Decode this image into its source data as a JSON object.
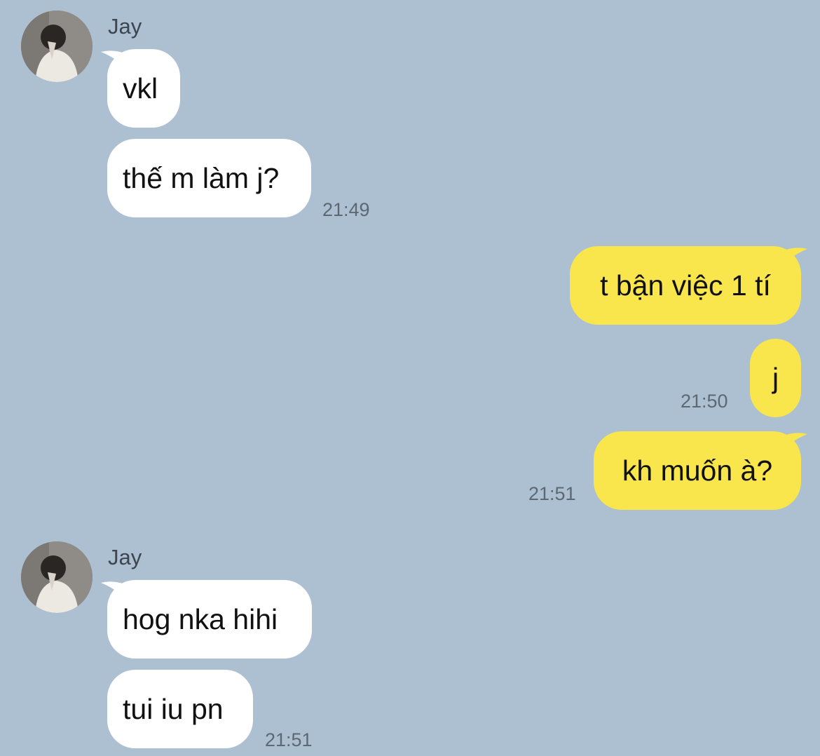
{
  "chat": {
    "groups": [
      {
        "sender": "Jay",
        "messages": [
          "vkl",
          "thế m làm j?"
        ],
        "time": "21:49"
      },
      {
        "outgoing": [
          {
            "text": "t bận việc 1 tí",
            "time": ""
          },
          {
            "text": "j",
            "time": "21:50"
          },
          {
            "text": "kh muốn à?",
            "time": "21:51"
          }
        ]
      },
      {
        "sender": "Jay",
        "messages": [
          "hog nka hihi",
          "tui iu pn"
        ],
        "time": "21:51"
      }
    ]
  },
  "colors": {
    "background": "#adc0d1",
    "incoming_bubble": "#ffffff",
    "outgoing_bubble": "#f9e54c",
    "timestamp": "#5d6872"
  },
  "icons": {
    "avatar": "user-avatar-photo"
  }
}
